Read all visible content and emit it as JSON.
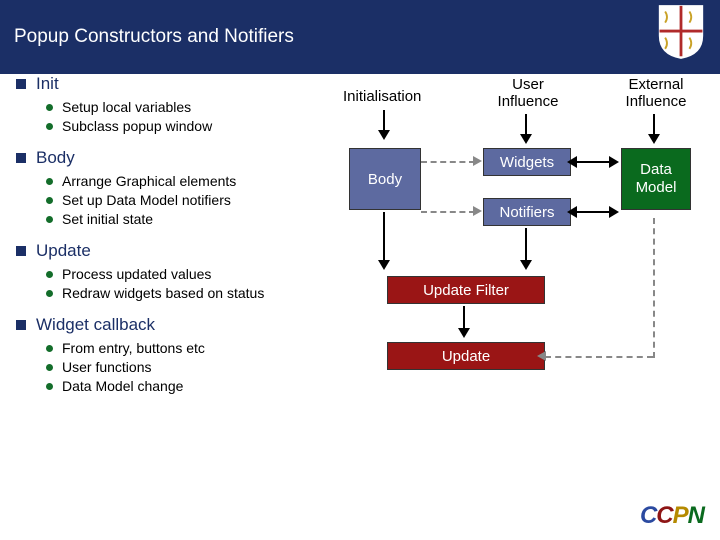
{
  "header": {
    "title": "Popup Constructors and Notifiers"
  },
  "outline": {
    "sections": [
      {
        "title": "Init",
        "items": [
          "Setup local variables",
          "Subclass popup window"
        ]
      },
      {
        "title": "Body",
        "items": [
          "Arrange Graphical elements",
          "Set up Data Model notifiers",
          "Set initial state"
        ]
      },
      {
        "title": "Update",
        "items": [
          "Process updated values",
          "Redraw widgets based on status"
        ]
      },
      {
        "title": "Widget callback",
        "items": [
          "From entry, buttons etc",
          "User functions",
          "Data Model change"
        ]
      }
    ]
  },
  "diagram": {
    "labels": {
      "initialisation": "Initialisation",
      "user_influence_1": "User",
      "user_influence_2": "Influence",
      "external_influence_1": "External",
      "external_influence_2": "Influence"
    },
    "boxes": {
      "body": "Body",
      "widgets": "Widgets",
      "notifiers": "Notifiers",
      "data_1": "Data",
      "data_2": "Model",
      "update_filter": "Update Filter",
      "update": "Update"
    }
  },
  "logo": {
    "c1": "C",
    "c2": "C",
    "c3": "P",
    "c4": "N"
  }
}
